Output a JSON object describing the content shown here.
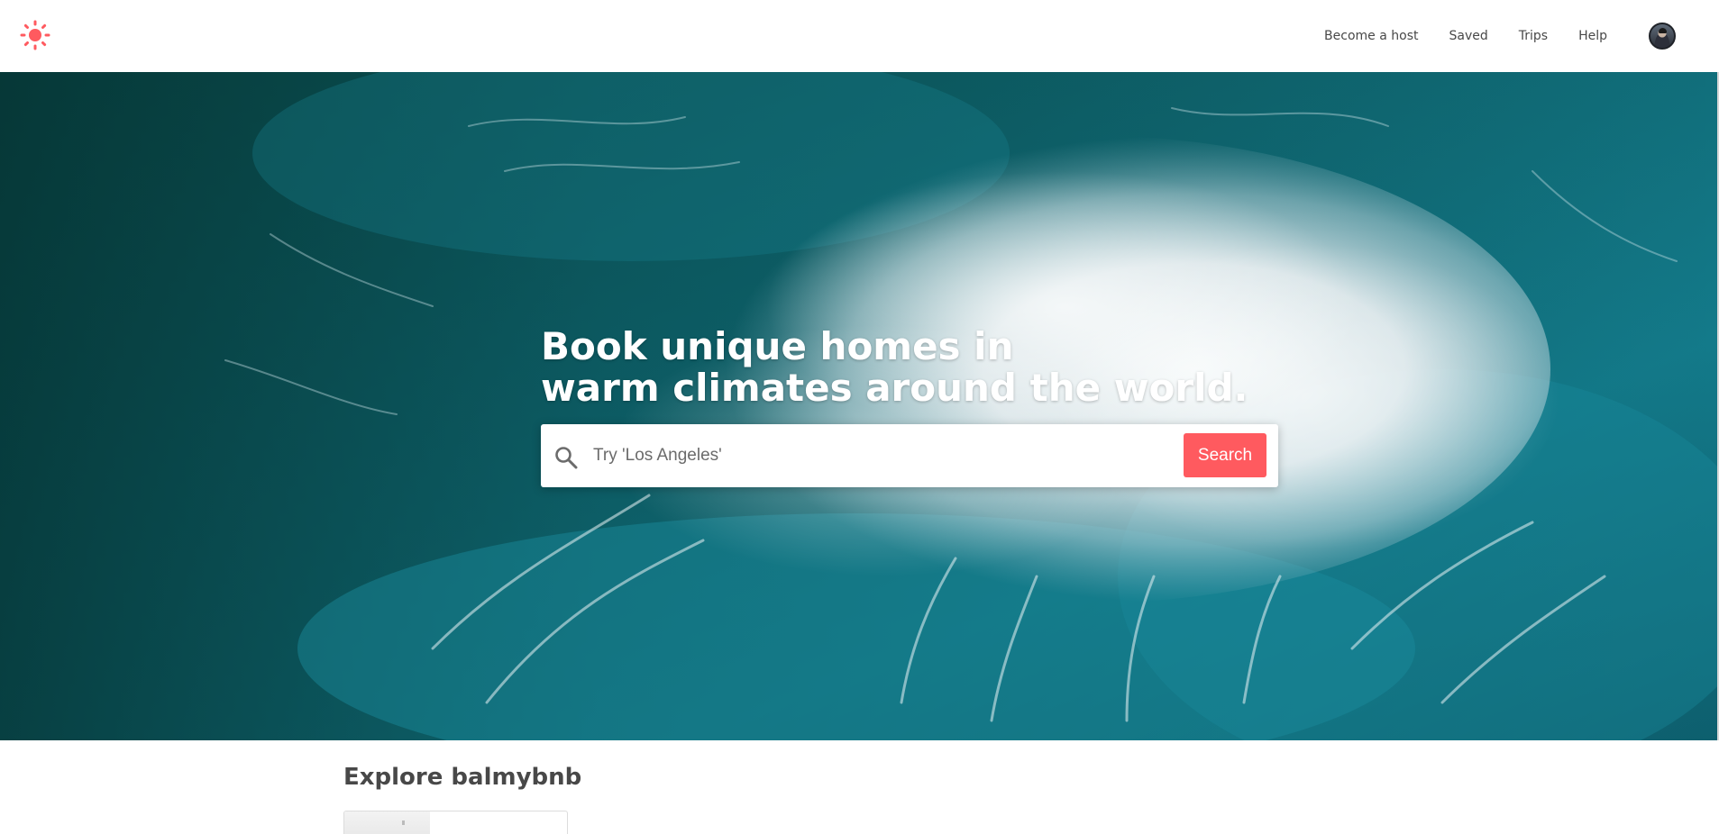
{
  "header": {
    "logo_icon": "sun-icon",
    "brand_color": "#ff5a5f",
    "nav": [
      {
        "label": "Become a host"
      },
      {
        "label": "Saved"
      },
      {
        "label": "Trips"
      },
      {
        "label": "Help"
      }
    ],
    "avatar_icon": "user-avatar"
  },
  "hero": {
    "headline_line1": "Book unique homes in",
    "headline_line2": "warm climates around the world.",
    "search": {
      "icon": "search-icon",
      "placeholder": "Try 'Los Angeles'",
      "value": "",
      "button_label": "Search"
    }
  },
  "explore": {
    "title": "Explore balmybnb"
  }
}
